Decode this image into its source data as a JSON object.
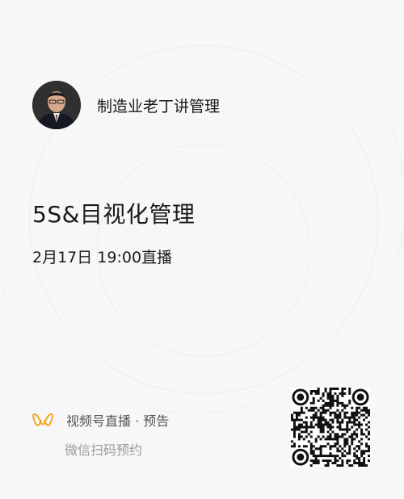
{
  "channel": {
    "name": "制造业老丁讲管理"
  },
  "live": {
    "title": "5S&目视化管理",
    "time": "2月17日 19:00直播"
  },
  "footer": {
    "brand": "视频号直播 · 预告",
    "hint": "微信扫码预约"
  },
  "colors": {
    "accent": "#f5a623",
    "background": "#f7f7f7"
  },
  "icons": {
    "brand": "wechat-channels-logo-icon",
    "qr": "qr-code"
  }
}
